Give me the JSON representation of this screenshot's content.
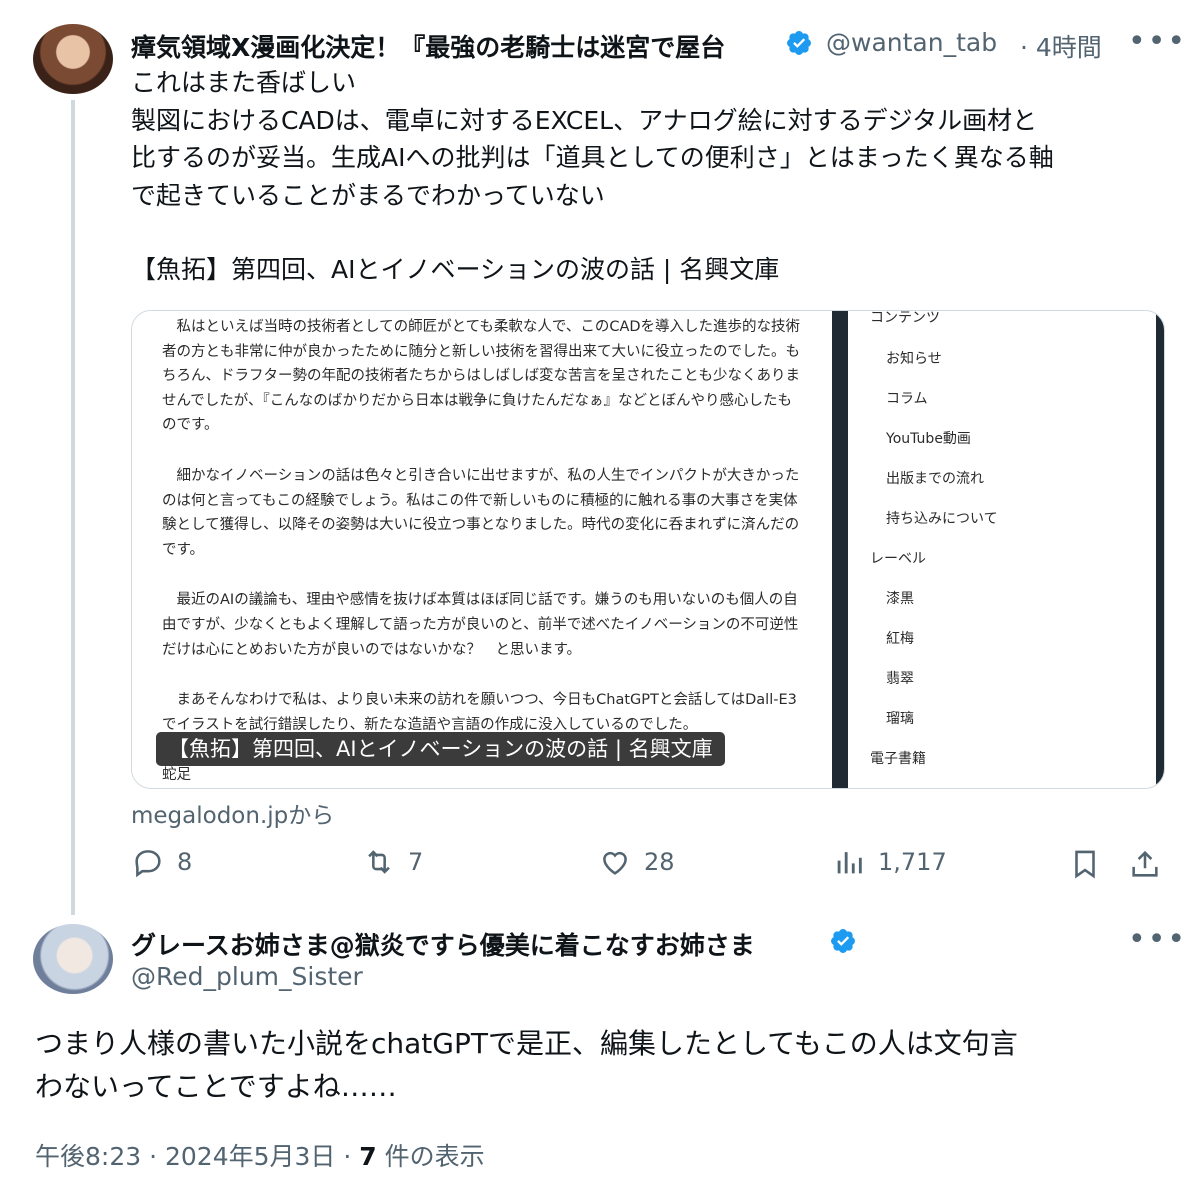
{
  "tweet1": {
    "display_name": "瘴気領域X漫画化決定！『最強の老騎士は迷宮で屋台",
    "handle": "@wantan_tab",
    "time": "· 4時間",
    "more": "•••",
    "text_lines": [
      "これはまた香ばしい",
      "製図におけるCADは、電卓に対するEXCEL、アナログ絵に対するデジタル画材と",
      "比するのが妥当。生成AIへの批判は「道具としての便利さ」とはまったく異なる軸",
      "で起きていることがまるでわかっていない"
    ],
    "link_title": "【魚拓】第四回、AIとイノベーションの波の話 | 名興文庫",
    "card": {
      "paragraphs": [
        "私はといえば当時の技術者としての師匠がとても柔軟な人で、このCADを導入した進歩的な技術者の方とも非常に仲が良かったために随分と新しい技術を習得出来て大いに役立ったのでした。もちろん、ドラフター勢の年配の技術者たちからはしばしば変な苦言を呈されたことも少なくありませんでしたが、『こんなのばかりだから日本は戦争に負けたんだなぁ』などとぼんやり感心したものです。",
        "細かなイノベーションの話は色々と引き合いに出せますが、私の人生でインパクトが大きかったのは何と言ってもこの経験でしょう。私はこの件で新しいものに積極的に触れる事の大事さを実体験として獲得し、以降その姿勢は大いに役立つ事となりました。時代の変化に呑まれずに済んだのです。",
        "最近のAIの議論も、理由や感情を抜けば本質はほぼ同じ話です。嫌うのも用いないのも個人の自由ですが、少なくともよく理解して語った方が良いのと、前半で述べたイノベーションの不可逆性だけは心にとめおいた方が良いのではないかな？　と思います。",
        "まあそんなわけで私は、より良い未来の訪れを願いつつ、今日もChatGPTと会話してはDall-E3でイラストを試行錯誤したり、新たな造語や言語の作成に没入しているのでした。",
        "蛇足"
      ],
      "overlay_title": "【魚拓】第四回、AIとイノベーションの波の話 | 名興文庫",
      "side_items": [
        "コンテンツ",
        "お知らせ",
        "コラム",
        "YouTube動画",
        "出版までの流れ",
        "持ち込みについて",
        "レーベル",
        "漆黒",
        "紅梅",
        "翡翠",
        "瑠璃",
        "電子書籍"
      ]
    },
    "source": "megalodon.jpから",
    "actions": {
      "replies": "8",
      "retweets": "7",
      "likes": "28",
      "views": "1,717"
    }
  },
  "tweet2": {
    "display_name": "グレースお姉さま@獄炎ですら優美に着こなすお姉さま",
    "handle": "@Red_plum_Sister",
    "more": "•••",
    "text_lines": [
      "つまり人様の書いた小説をchatGPTで是正、編集したとしてもこの人は文句言",
      "わないってことですよね……"
    ],
    "timestamp": "午後8:23 · 2024年5月3日 · ",
    "views_count": "7",
    "views_label": " 件の表示"
  },
  "colors": {
    "verified_blue": "#1d9bf0",
    "secondary_text": "#536471",
    "primary_text": "#0f1419",
    "border": "#cfd9de"
  }
}
